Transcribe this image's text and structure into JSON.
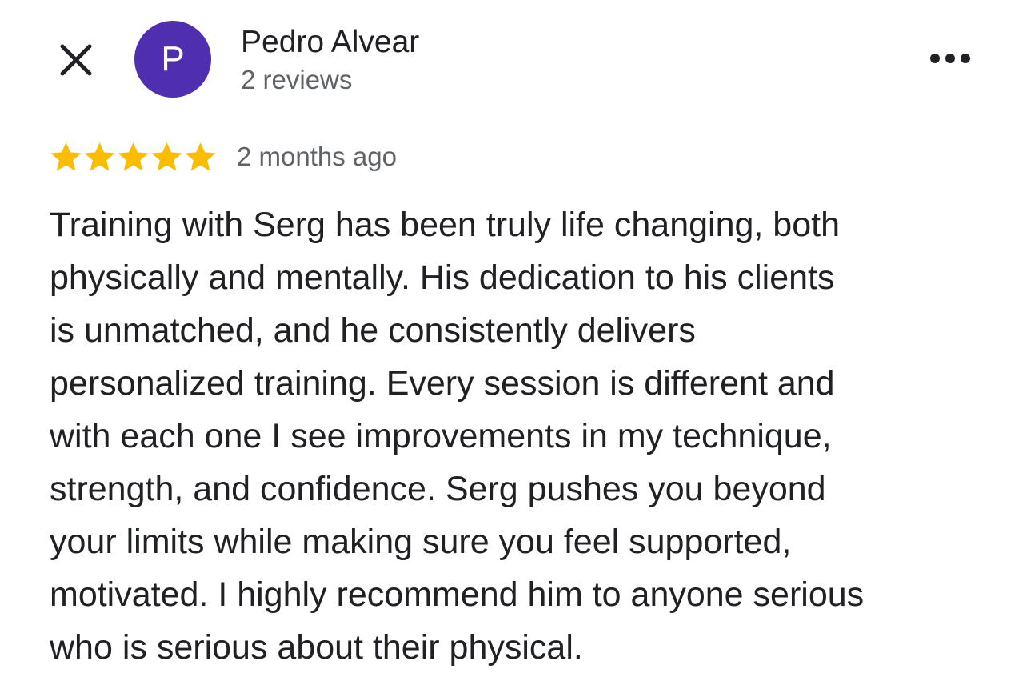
{
  "header": {
    "close_icon": "close-icon",
    "avatar_letter": "P",
    "avatar_color": "#4f2fb0",
    "user_name": "Pedro Alvear",
    "review_count": "2 reviews",
    "more_icon": "more-horizontal-icon"
  },
  "review": {
    "rating": 5,
    "rating_max": 5,
    "star_color": "#fbbc04",
    "date": "2 months ago",
    "text_lines": [
      "Training with Serg has been truly life changing, both",
      "physically and mentally. His dedication to his clients",
      "is unmatched, and he consistently delivers",
      "personalized training. Every session is different and",
      "with each one I see improvements in my technique,",
      "strength, and confidence. Serg pushes you beyond",
      "your limits while making sure you feel supported,",
      "motivated. I highly recommend him to anyone serious",
      "who is serious about their physical."
    ]
  }
}
